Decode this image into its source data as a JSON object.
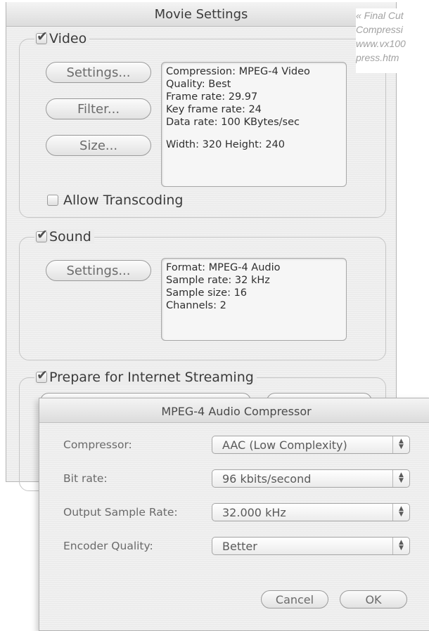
{
  "window": {
    "title": "Movie Settings"
  },
  "caption": [
    "« Final Cut",
    "Compressi",
    "www.vx100",
    "press.htm"
  ],
  "video": {
    "label": "Video",
    "checked": true,
    "buttons": {
      "settings": "Settings...",
      "filter": "Filter...",
      "size": "Size..."
    },
    "info": [
      "Compression: MPEG-4 Video",
      "Quality: Best",
      "Frame rate: 29.97",
      "Key frame rate: 24",
      "Data rate: 100 KBytes/sec",
      "Width: 320 Height: 240"
    ],
    "allow_transcoding": {
      "label": "Allow Transcoding",
      "checked": false
    }
  },
  "sound": {
    "label": "Sound",
    "checked": true,
    "buttons": {
      "settings": "Settings..."
    },
    "info": [
      "Format: MPEG-4 Audio",
      "Sample rate: 32 kHz",
      "Sample size: 16",
      "Channels: 2"
    ]
  },
  "streaming": {
    "label": "Prepare for Internet Streaming",
    "checked": true
  },
  "dialog": {
    "title": "MPEG-4 Audio Compressor",
    "rows": [
      {
        "label": "Compressor:",
        "value": "AAC (Low Complexity)"
      },
      {
        "label": "Bit rate:",
        "value": "96 kbits/second"
      },
      {
        "label": "Output Sample Rate:",
        "value": "32.000 kHz"
      },
      {
        "label": "Encoder Quality:",
        "value": "Better"
      }
    ],
    "buttons": {
      "cancel": "Cancel",
      "ok": "OK"
    }
  }
}
